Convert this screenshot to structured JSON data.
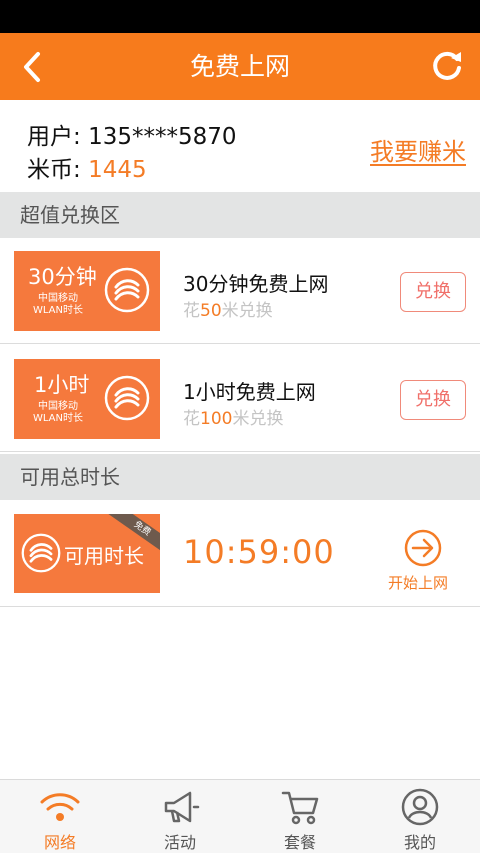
{
  "header": {
    "title": "免费上网",
    "back_icon": "back-arrow-icon",
    "refresh_icon": "refresh-icon"
  },
  "user": {
    "phone_label": "用户: ",
    "phone": "135****5870",
    "coins_label": "米币: ",
    "coins": "1445",
    "earn_link": "我要赚米"
  },
  "exchange_section": {
    "title": "超值兑换区",
    "items": [
      {
        "card_big": "30分钟",
        "card_small1": "中国移动",
        "card_small2": "WLAN时长",
        "name": "30分钟免费上网",
        "cost_prefix": "花",
        "cost_amount": "50",
        "cost_suffix": "米兑换",
        "button": "兑换"
      },
      {
        "card_big": "1小时",
        "card_small1": "中国移动",
        "card_small2": "WLAN时长",
        "name": "1小时免费上网",
        "cost_prefix": "花",
        "cost_amount": "100",
        "cost_suffix": "米兑换",
        "button": "兑换"
      }
    ]
  },
  "available_section": {
    "title": "可用总时长",
    "card_label": "可用时长",
    "ribbon": "免费",
    "time": "10:59:00",
    "go_label": "开始上网"
  },
  "tabs": [
    {
      "label": "网络",
      "icon": "wifi-icon",
      "active": true
    },
    {
      "label": "活动",
      "icon": "megaphone-icon",
      "active": false
    },
    {
      "label": "套餐",
      "icon": "cart-icon",
      "active": false
    },
    {
      "label": "我的",
      "icon": "user-icon",
      "active": false
    }
  ],
  "colors": {
    "accent": "#f77b1c",
    "card": "#f5793d",
    "section_bg": "#e3e4e4"
  }
}
